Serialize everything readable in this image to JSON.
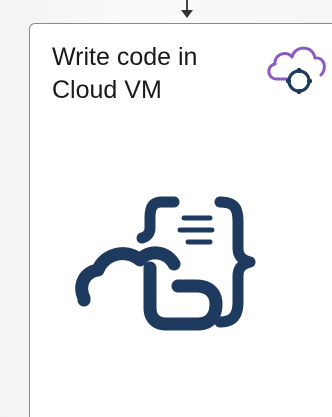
{
  "node": {
    "title": "Write code in\nCloud VM"
  },
  "icons": {
    "header_icon": "cloud-sync-icon",
    "main_icon": "cloud-code-icon"
  },
  "colors": {
    "card_border": "#8a8a8a",
    "icon_navy": "#1f3a5f",
    "icon_purple": "#7a4fb0",
    "title_text": "#1a1a1a"
  }
}
